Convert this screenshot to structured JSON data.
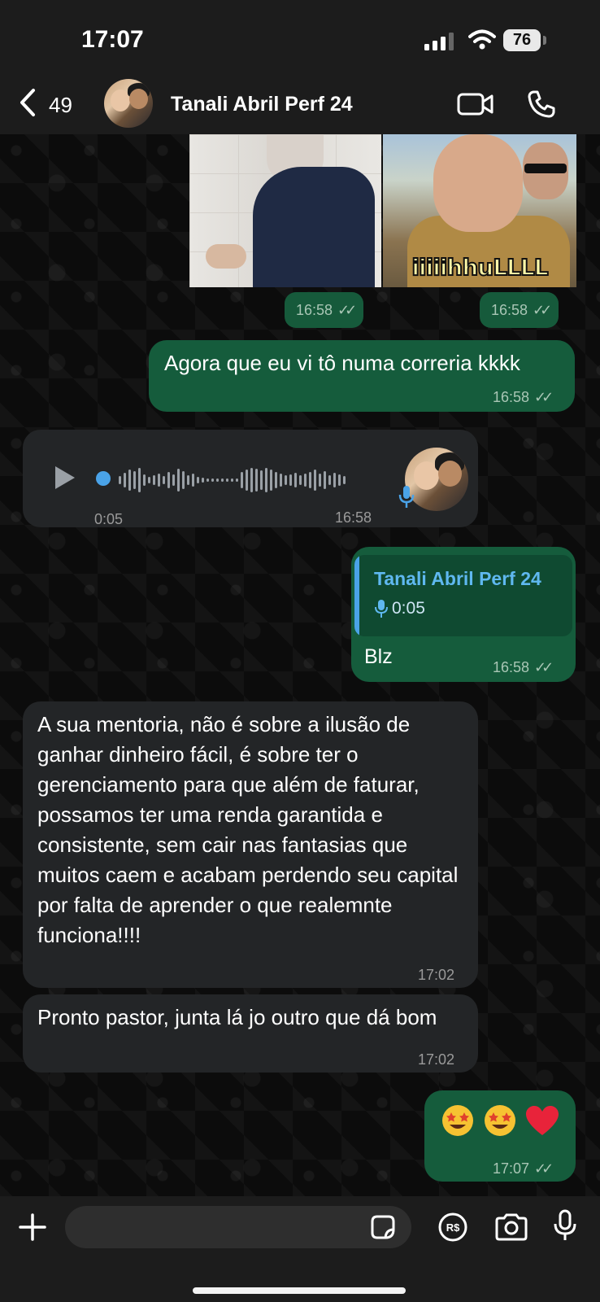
{
  "status": {
    "time": "17:07",
    "battery": "76"
  },
  "header": {
    "back_count": "49",
    "contact_name": "Tanali Abril Perf 24"
  },
  "media": {
    "right_caption": "iiiiihhuLLLL",
    "left_time": "16:58",
    "right_time": "16:58"
  },
  "messages": [
    {
      "direction": "out",
      "text": "Agora que eu vi tô numa correria kkkk",
      "time": "16:58"
    },
    {
      "direction": "in",
      "type": "voice",
      "duration": "0:05",
      "time": "16:58"
    },
    {
      "direction": "out",
      "reply_to": "Tanali Abril Perf 24",
      "reply_duration": "0:05",
      "text": "Blz",
      "time": "16:58"
    },
    {
      "direction": "in",
      "text": "A sua mentoria, não é sobre a ilusão de ganhar dinheiro fácil, é sobre ter o gerenciamento para que além de faturar, possamos ter uma renda garantida e consistente, sem cair nas fantasias que muitos caem e acabam perdendo seu capital por falta de aprender o que realemnte funciona!!!!",
      "time": "17:02"
    },
    {
      "direction": "in",
      "text": "Pronto pastor, junta lá jo outro que dá bom",
      "time": "17:02"
    },
    {
      "direction": "out",
      "emojis": [
        "star-struck",
        "star-struck",
        "red-heart"
      ],
      "time": "17:07"
    }
  ],
  "colors": {
    "outgoing_bubble": "#155c3c",
    "incoming_bubble": "#232527",
    "reply_accent": "#4aa3e8",
    "reply_name": "#5fb8f0"
  }
}
